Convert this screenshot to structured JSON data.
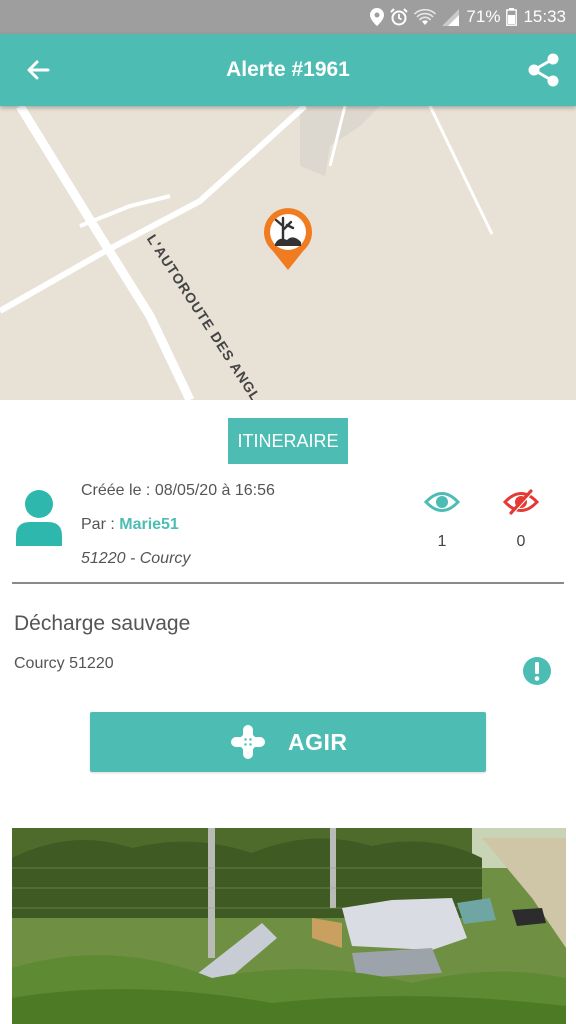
{
  "status_bar": {
    "battery": "71%",
    "time": "15:33",
    "icons": [
      "location-icon",
      "alarm-icon",
      "wifi-icon",
      "signal-icon",
      "battery-icon"
    ]
  },
  "app_bar": {
    "title": "Alerte #1961",
    "back_icon": "arrow-left-icon",
    "share_icon": "share-icon"
  },
  "map": {
    "road_label": "L'AUTOROUTE DES ANGLAIS",
    "marker_icon": "illegal-dump-marker-icon"
  },
  "actions": {
    "itineraire_label": "ITINERAIRE",
    "agir_label": "AGIR"
  },
  "details": {
    "created_label": "Créée le : 08/05/20 à 16:56",
    "by_prefix": "Par : ",
    "author": "Marie51",
    "location": "51220 - Courcy",
    "seen_count": "1",
    "unseen_count": "0"
  },
  "alert": {
    "type": "Décharge sauvage",
    "address": "Courcy 51220"
  },
  "colors": {
    "accent": "#4dbdb4",
    "status_bar": "#9e9e9e",
    "danger": "#e53935",
    "marker": "#f07b20",
    "map_background": "#e7e1d6"
  }
}
